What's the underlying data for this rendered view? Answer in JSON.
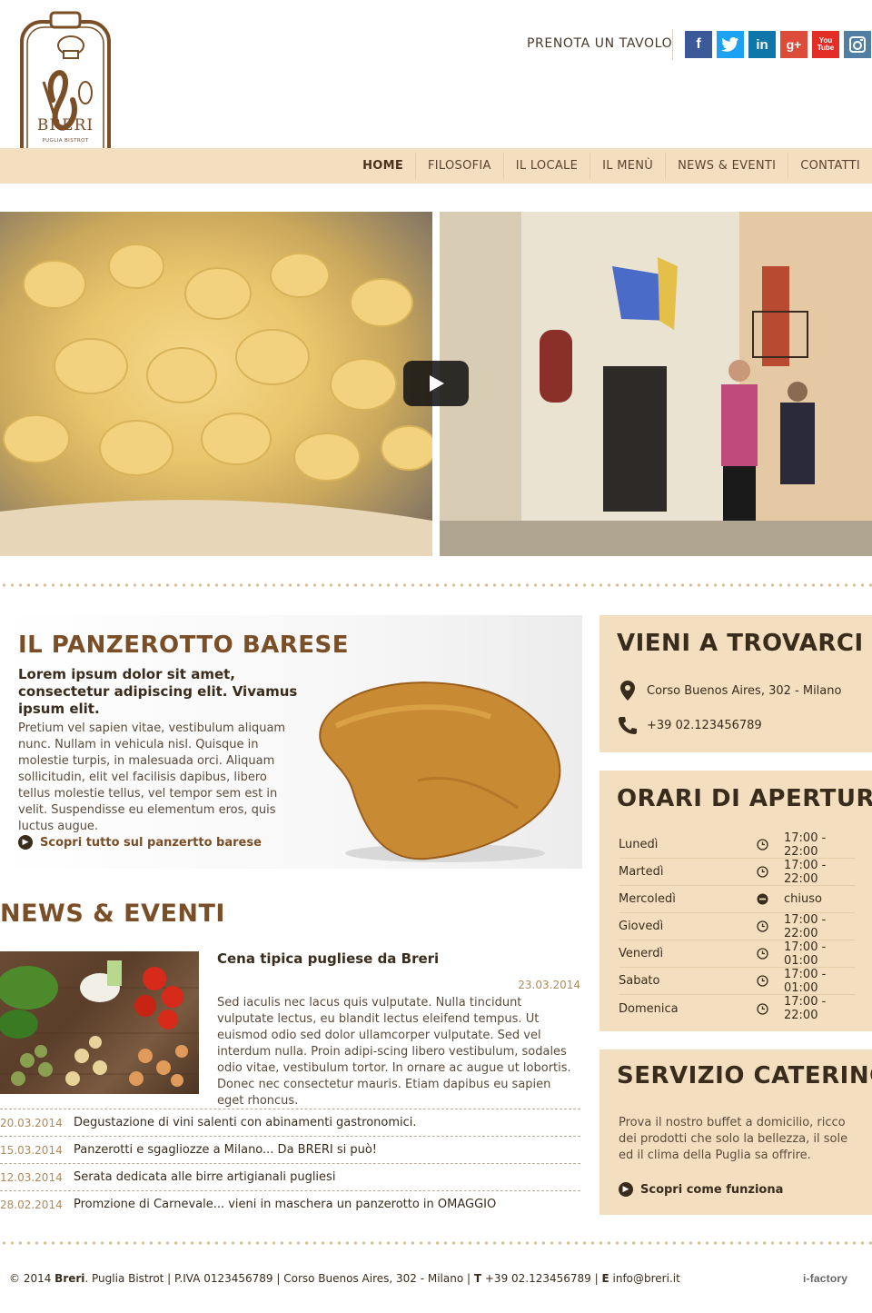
{
  "brand": {
    "logo_text": "BRERI",
    "logo_sub": "PUGLIA BISTROT",
    "colors": {
      "brown": "#7a4e26",
      "cream": "#f3dfc0",
      "dark": "#3a2c1c"
    }
  },
  "header": {
    "reserve_label": "PRENOTA UN TAVOLO",
    "social": [
      {
        "icon": "facebook-icon",
        "glyph": "f",
        "color": "#3b5998"
      },
      {
        "icon": "twitter-icon",
        "glyph": "t",
        "color": "#1da1f2"
      },
      {
        "icon": "linkedin-icon",
        "glyph": "in",
        "color": "#0e76a8"
      },
      {
        "icon": "googleplus-icon",
        "glyph": "g+",
        "color": "#dd4b39"
      },
      {
        "icon": "youtube-icon",
        "glyph": "You Tube",
        "color": "#e52d27"
      },
      {
        "icon": "instagram-icon",
        "glyph": "◘",
        "color": "#517fa4"
      }
    ]
  },
  "nav": {
    "items": [
      "HOME",
      "FILOSOFIA",
      "IL LOCALE",
      "IL MENÙ",
      "NEWS & EVENTI",
      "CONTATTI"
    ],
    "active": 0
  },
  "panzerotto": {
    "title_light": "IL PANZEROTTO ",
    "title_bold": "BARESE",
    "subtitle": "Lorem ipsum dolor sit amet, consectetur adipiscing elit. Vivamus ipsum elit.",
    "body": "Pretium vel sapien vitae, vestibulum aliquam nunc. Nullam in vehicula nisl. Quisque in molestie turpis, in malesuada orci. Aliquam sollicitudin, elit vel facilisis dapibus, libero tellus molestie tellus, vel tempor sem est in velit. Suspendisse eu elementum eros, quis luctus augue.",
    "link": "Scopri tutto sul panzertto barese"
  },
  "news": {
    "title_bold": "NEWS",
    "title_light": " & EVENTI",
    "featured": {
      "title": "Cena tipica pugliese da Breri",
      "date": "23.03.2014",
      "body": "Sed iaculis nec lacus quis vulputate. Nulla tincidunt vulputate lectus, eu blandit lectus eleifend tempus. Ut euismod odio sed dolor ullamcorper vulputate. Sed vel interdum nulla. Proin adipi-scing libero vestibulum, sodales odio vitae, vestibulum tortor. In ornare ac augue ut lobortis. Donec nec consectetur mauris. Etiam dapibus eu sapien eget rhoncus."
    },
    "items": [
      {
        "date": "20.03.2014",
        "title": "Degustazione di vini salenti con abinamenti gastronomici."
      },
      {
        "date": "15.03.2014",
        "title": "Panzerotti e sgagliozze a Milano... Da BRERI si può!"
      },
      {
        "date": "12.03.2014",
        "title": "Serata dedicata alle birre artigianali pugliesi"
      },
      {
        "date": "28.02.2014",
        "title": "Promzione di Carnevale... vieni in maschera un panzerotto in OMAGGIO"
      }
    ]
  },
  "visit": {
    "title_light": "VIENI A ",
    "title_bold": "TROVARCI",
    "address": "Corso Buenos Aires, 302 - Milano",
    "phone": "+39 02.123456789"
  },
  "hours": {
    "title_bold": "ORARI",
    "title_light": " DI APERTURA",
    "rows": [
      {
        "day": "Lunedì",
        "time": "17:00 - 22:00",
        "closed": false
      },
      {
        "day": "Martedì",
        "time": "17:00 - 22:00",
        "closed": false
      },
      {
        "day": "Mercoledì",
        "time": "chiuso",
        "closed": true
      },
      {
        "day": "Giovedì",
        "time": "17:00 - 22:00",
        "closed": false
      },
      {
        "day": "Venerdì",
        "time": "17:00 - 01:00",
        "closed": false
      },
      {
        "day": "Sabato",
        "time": "17:00 - 01:00",
        "closed": false
      },
      {
        "day": "Domenica",
        "time": "17:00 - 22:00",
        "closed": false
      }
    ]
  },
  "catering": {
    "title_light": "SERVIZIO ",
    "title_bold": "CATERING",
    "body": "Prova il nostro buffet a domicilio, ricco dei prodotti che solo la bellezza, il sole ed il clima della Puglia sa offrire.",
    "link": "Scopri come funziona"
  },
  "footer": {
    "copyright": "© 2014 ",
    "brand": "Breri",
    "rest": ". Puglia Bistrot  |  P.IVA 0123456789  |  Corso Buenos Aires, 302 - Milano  |  ",
    "phone_label": "T",
    "phone": " +39 02.123456789  |  ",
    "email_label": "E",
    "email": " info@breri.it",
    "credit": "i-factory"
  }
}
